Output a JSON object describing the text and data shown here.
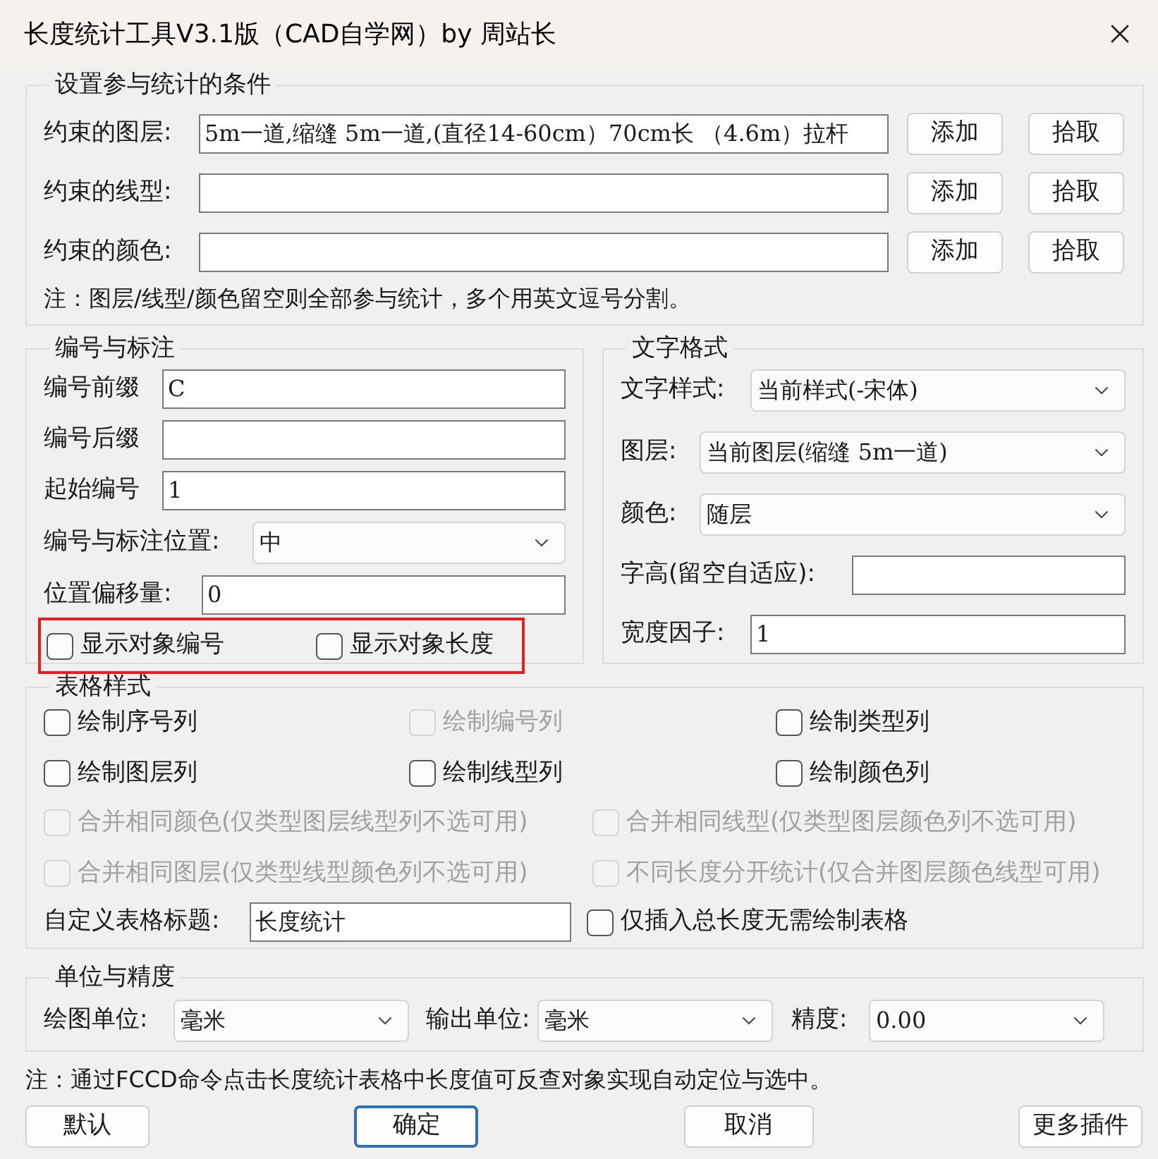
{
  "window": {
    "title": "长度统计工具V3.1版（CAD自学网）by 周站长"
  },
  "conditions": {
    "title": "设置参与统计的条件",
    "rows": [
      {
        "label": "约束的图层:",
        "value": "5m一道,缩缝  5m一道,(直径14-60cm）70cm长 （4.6m）拉杆",
        "buttons": [
          "添加",
          "拾取"
        ]
      },
      {
        "label": "约束的线型:",
        "buttons": [
          "添加",
          "拾取"
        ]
      },
      {
        "label": "约束的颜色:",
        "buttons": [
          "添加",
          "拾取"
        ]
      }
    ],
    "note": "注：图层/线型/颜色留空则全部参与统计，多个用英文逗号分割。"
  },
  "numbering": {
    "title": "编号与标注",
    "fields": [
      {
        "kind": "input",
        "label": "编号前缀",
        "value": "C"
      },
      {
        "kind": "input",
        "label": "编号后缀"
      },
      {
        "kind": "input",
        "label": "起始编号",
        "value": "1"
      },
      {
        "kind": "select",
        "label": "编号与标注位置:",
        "value": "中"
      },
      {
        "kind": "input",
        "label": "位置偏移量:",
        "value": "0"
      }
    ],
    "checkboxes": [
      {
        "label": "显示对象编号",
        "checked": false
      },
      {
        "label": "显示对象长度",
        "checked": false
      }
    ]
  },
  "text_format": {
    "title": "文字格式",
    "fields": [
      {
        "kind": "select",
        "label": "文字样式:",
        "value": "当前样式(-宋体)"
      },
      {
        "kind": "select",
        "label": "图层:",
        "value": "当前图层(缩缝  5m一道)"
      },
      {
        "kind": "select",
        "label": "颜色:",
        "value": "随层"
      },
      {
        "kind": "input",
        "label": "字高(留空自适应):"
      },
      {
        "kind": "input",
        "label": "宽度因子:",
        "value": "1"
      }
    ]
  },
  "table_style": {
    "title": "表格样式",
    "columns": [
      {
        "label": "绘制序号列",
        "checked": false,
        "disabled": false
      },
      {
        "label": "绘制编号列",
        "checked": false,
        "disabled": true
      },
      {
        "label": "绘制类型列",
        "checked": false,
        "disabled": false
      },
      {
        "label": "绘制图层列",
        "checked": false,
        "disabled": false
      },
      {
        "label": "绘制线型列",
        "checked": false,
        "disabled": false
      },
      {
        "label": "绘制颜色列",
        "checked": false,
        "disabled": false
      }
    ],
    "merges": [
      {
        "label": "合并相同颜色(仅类型图层线型列不选可用)",
        "checked": false,
        "disabled": true
      },
      {
        "label": "合并相同线型(仅类型图层颜色列不选可用)",
        "checked": false,
        "disabled": true
      },
      {
        "label": "合并相同图层(仅类型线型颜色列不选可用)",
        "checked": false,
        "disabled": true
      },
      {
        "label": "不同长度分开统计(仅合并图层颜色线型可用)",
        "checked": false,
        "disabled": true
      }
    ],
    "title_field": {
      "label": "自定义表格标题:",
      "value": "长度统计"
    },
    "total_only": {
      "label": "仅插入总长度无需绘制表格",
      "checked": false,
      "disabled": false
    }
  },
  "units": {
    "title": "单位与精度",
    "fields": [
      {
        "label": "绘图单位:",
        "value": "毫米"
      },
      {
        "label": "输出单位:",
        "value": "毫米"
      },
      {
        "label": "精度:",
        "value": "0.00"
      }
    ]
  },
  "footer_note": "注：通过FCCD命令点击长度统计表格中长度值可反查对象实现自动定位与选中。",
  "buttons": [
    {
      "label": "默认",
      "default": false
    },
    {
      "label": "确定",
      "default": true
    },
    {
      "label": "取消",
      "default": false
    },
    {
      "label": "更多插件",
      "default": false
    }
  ]
}
